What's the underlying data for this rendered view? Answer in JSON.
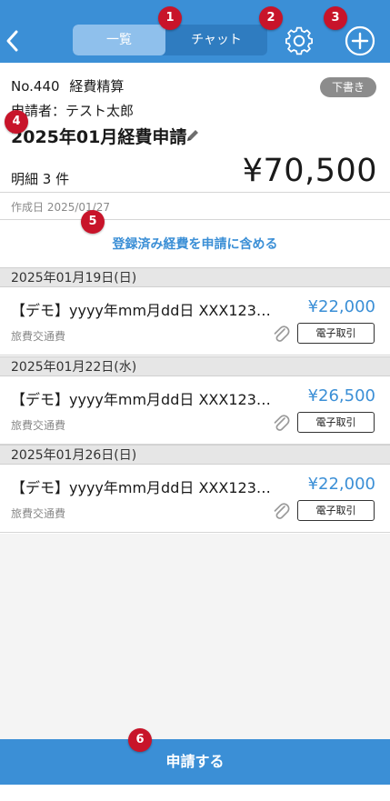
{
  "header": {
    "tabs": [
      {
        "label": "一覧",
        "active": true
      },
      {
        "label": "チャット",
        "active": false
      }
    ],
    "back_icon": "chevron-left-icon",
    "settings_icon": "gear-icon",
    "add_icon": "plus-circle-icon"
  },
  "markers": [
    "1",
    "2",
    "3",
    "4",
    "5",
    "6"
  ],
  "report": {
    "number": "No.440",
    "type": "経費精算",
    "status_badge": "下書き",
    "applicant": "申請者：テスト太郎",
    "title": "2025年01月経費申請",
    "count": "明細 3 件",
    "total": "¥70,500",
    "created": "作成日 2025/01/27"
  },
  "include_link": "登録済み経費を申請に含める",
  "groups": [
    {
      "date": "2025年01月19日(日)",
      "items": [
        {
          "title": "【デモ】yyyy年mm月dd日 XXX123…",
          "amount": "¥22,000",
          "category": "旅費交通費",
          "tag": "電子取引"
        }
      ]
    },
    {
      "date": "2025年01月22日(水)",
      "items": [
        {
          "title": "【デモ】yyyy年mm月dd日 XXX123…",
          "amount": "¥26,500",
          "category": "旅費交通費",
          "tag": "電子取引"
        }
      ]
    },
    {
      "date": "2025年01月26日(日)",
      "items": [
        {
          "title": "【デモ】yyyy年mm月dd日 XXX123…",
          "amount": "¥22,000",
          "category": "旅費交通費",
          "tag": "電子取引"
        }
      ]
    }
  ],
  "submit_label": "申請する",
  "colors": {
    "accent": "#3b8fd6",
    "badge": "#8c8c8c",
    "marker": "#c8142a"
  }
}
